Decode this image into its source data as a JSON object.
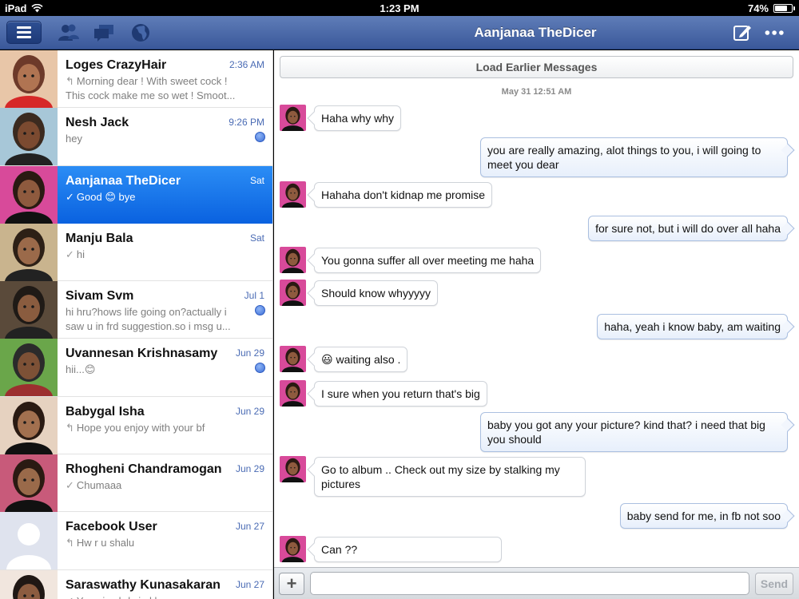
{
  "status_bar": {
    "device": "iPad",
    "time": "1:23 PM",
    "battery": "74%",
    "battery_level": 0.74
  },
  "nav": {
    "title": "Aanjanaa TheDicer",
    "icons": [
      "menu-icon",
      "friends-icon",
      "messages-icon",
      "globe-icon",
      "compose-icon",
      "more-icon"
    ]
  },
  "conversations": [
    {
      "name": "Loges CrazyHair",
      "date": "2:36 AM",
      "preview": "Morning dear ! With sweet cock ! This cock make me so wet ! Smoot...",
      "mark": "reply",
      "unread": false
    },
    {
      "name": "Nesh Jack",
      "date": "9:26 PM",
      "preview": "hey",
      "mark": "",
      "unread": true
    },
    {
      "name": "Aanjanaa TheDicer",
      "date": "Sat",
      "preview": "Good 😊 bye",
      "mark": "check",
      "unread": false,
      "selected": true
    },
    {
      "name": "Manju Bala",
      "date": "Sat",
      "preview": "hi",
      "mark": "check",
      "unread": false
    },
    {
      "name": "Sivam Svm",
      "date": "Jul 1",
      "preview": "hi hru?hows life going on?actually i saw u in frd suggestion.so i msg u...",
      "mark": "",
      "unread": true
    },
    {
      "name": "Uvannesan Krishnasamy",
      "date": "Jun 29",
      "preview": "hii...😊",
      "mark": "",
      "unread": true
    },
    {
      "name": "Babygal Isha",
      "date": "Jun 29",
      "preview": "Hope you enjoy with your bf",
      "mark": "reply",
      "unread": false
    },
    {
      "name": "Rhogheni Chandramogan",
      "date": "Jun 29",
      "preview": "Chumaaa",
      "mark": "check",
      "unread": false
    },
    {
      "name": "Facebook User",
      "date": "Jun 27",
      "preview": "Hw r u shalu",
      "mark": "reply",
      "unread": false
    },
    {
      "name": "Saraswathy Kunasakaran",
      "date": "Jun 27",
      "preview": "Yup sis alrdy in kl",
      "mark": "check",
      "unread": false
    }
  ],
  "chat": {
    "load_earlier": "Load Earlier Messages",
    "date_separator": "May 31 12:51 AM",
    "messages": [
      {
        "dir": "in",
        "text": "Haha why why"
      },
      {
        "dir": "out",
        "text": "you are really amazing, alot things to you, i will going to meet you dear"
      },
      {
        "dir": "in",
        "text": "Hahaha don't kidnap me promise"
      },
      {
        "dir": "out",
        "text": "for sure not, but i will do over all haha"
      },
      {
        "dir": "in",
        "text": "You gonna suffer all over meeting me haha"
      },
      {
        "dir": "in",
        "text": "Should know whyyyyy"
      },
      {
        "dir": "out",
        "text": "haha, yeah i know baby, am waiting"
      },
      {
        "dir": "in",
        "text": "😃 waiting also ."
      },
      {
        "dir": "in",
        "text": "I sure when you return  that's big"
      },
      {
        "dir": "out",
        "text": "baby you got any your picture? kind that? i need that big you should"
      },
      {
        "dir": "in",
        "text": "Go to album .. Check out my size by stalking my pictures"
      },
      {
        "dir": "out",
        "text": "baby send for me, in fb not soo"
      },
      {
        "dir": "in",
        "text": "Can ??"
      }
    ]
  },
  "composer": {
    "add_label": "+",
    "placeholder": "",
    "send_label": "Send"
  },
  "colors": {
    "nav_top": "#5f7db8",
    "nav_bottom": "#3a589a",
    "selected_row": "#1a74ea",
    "date_blue": "#4a6bb4"
  }
}
